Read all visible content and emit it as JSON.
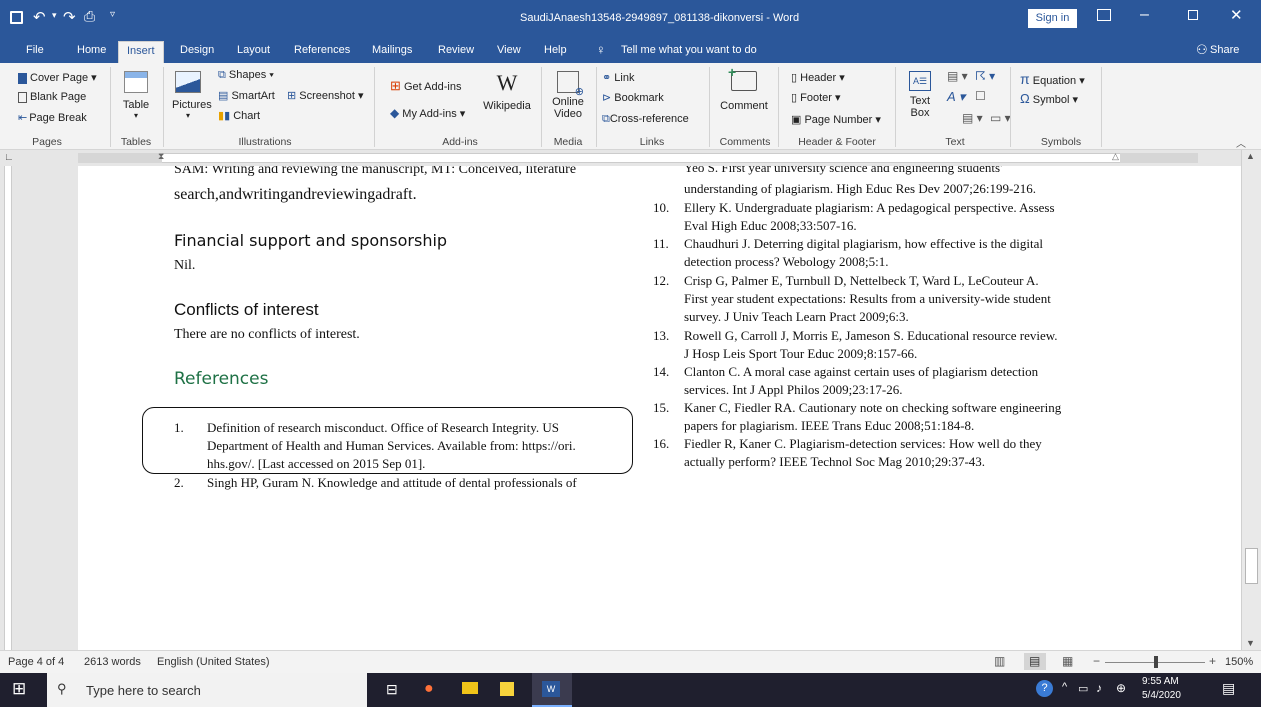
{
  "window": {
    "title": "SaudiJAnaesh13548-2949897_081138-dikonversi  -  Word",
    "sign_in": "Sign in"
  },
  "tabs": [
    "File",
    "Home",
    "Insert",
    "Design",
    "Layout",
    "References",
    "Mailings",
    "Review",
    "View",
    "Help"
  ],
  "tell_me": "Tell me what you want to do",
  "share": "Share",
  "ribbon": {
    "pages": {
      "items": [
        "Cover Page",
        "Blank Page",
        "Page Break"
      ],
      "label": "Pages"
    },
    "tables": {
      "button": "Table",
      "label": "Tables"
    },
    "illustrations": {
      "pictures": "Pictures",
      "shapes": "Shapes",
      "smartart": "SmartArt",
      "chart": "Chart",
      "screenshot": "Screenshot",
      "label": "Illustrations"
    },
    "addins": {
      "get": "Get Add-ins",
      "my": "My Add-ins",
      "wikipedia": "Wikipedia",
      "label": "Add-ins"
    },
    "media": {
      "online_video": "Online Video",
      "label": "Media"
    },
    "links": {
      "link": "Link",
      "bookmark": "Bookmark",
      "cross": "Cross-reference",
      "label": "Links"
    },
    "comments": {
      "comment": "Comment",
      "label": "Comments"
    },
    "header_footer": {
      "header": "Header",
      "footer": "Footer",
      "page_number": "Page Number",
      "label": "Header & Footer"
    },
    "text": {
      "textbox": "Text Box",
      "label": "Text"
    },
    "symbols": {
      "equation": "Equation",
      "symbol": "Symbol",
      "label": "Symbols"
    }
  },
  "document": {
    "left_top_cut": "SAM: Writing and reviewing the manuscript, MT: Conceived, literature",
    "left_top_line2": "search,andwritingandreviewingadraft.",
    "fin_heading": "Financial support and sponsorship",
    "fin_body": "Nil.",
    "coi_heading": "Conflicts of interest",
    "coi_body": "There are no conflicts of interest.",
    "refs_heading": "References",
    "ref1_num": "1.",
    "ref1_lines": [
      "Definition of research misconduct. Office of Research Integrity. US",
      "Department of Health and Human Services. Available from: https://ori.",
      "hhs.gov/. [Last accessed on 2015 Sep 01]."
    ],
    "ref2_num": "2.",
    "ref2_line": "Singh HP, Guram N. Knowledge and attitude of dental professionals of",
    "right_top_cut": "Yeo S. First year university science and engineering students'",
    "right_refs": [
      {
        "num": "",
        "lines": [
          "understanding of plagiarism. High Educ Res Dev 2007;26:199-216."
        ]
      },
      {
        "num": "10.",
        "lines": [
          "Ellery K. Undergraduate plagiarism: A pedagogical perspective. Assess",
          "Eval High Educ 2008;33:507-16."
        ]
      },
      {
        "num": "11.",
        "lines": [
          "Chaudhuri J. Deterring digital plagiarism, how effective is the digital",
          "detection process? Webology 2008;5:1."
        ]
      },
      {
        "num": "12.",
        "lines": [
          "Crisp G, Palmer E, Turnbull D, Nettelbeck T, Ward L, LeCouteur A.",
          "First year student expectations: Results from a university-wide student",
          "survey. J Univ Teach Learn Pract 2009;6:3."
        ]
      },
      {
        "num": "13.",
        "lines": [
          "Rowell G, Carroll J, Morris E, Jameson S. Educational resource review.",
          "J Hosp Leis Sport Tour Educ 2009;8:157-66."
        ]
      },
      {
        "num": "14.",
        "lines": [
          "Clanton C. A moral case against certain uses of plagiarism detection",
          "services. Int J Appl Philos 2009;23:17-26."
        ]
      },
      {
        "num": "15.",
        "lines": [
          "Kaner C, Fiedler RA. Cautionary note on checking software engineering",
          "papers for plagiarism. IEEE Trans Educ 2008;51:184-8."
        ]
      },
      {
        "num": "16.",
        "lines": [
          "Fiedler R, Kaner C. Plagiarism-detection services: How well do they",
          "actually perform? IEEE Technol Soc Mag 2010;29:37-43."
        ]
      }
    ]
  },
  "status": {
    "page": "Page 4 of 4",
    "words": "2613 words",
    "lang": "English (United States)",
    "zoom": "150%"
  },
  "taskbar": {
    "search": "Type here to search",
    "time": "9:55 AM",
    "date": "5/4/2020"
  },
  "colors": {
    "word_blue": "#2b579a",
    "heading_green": "#1e7145"
  }
}
